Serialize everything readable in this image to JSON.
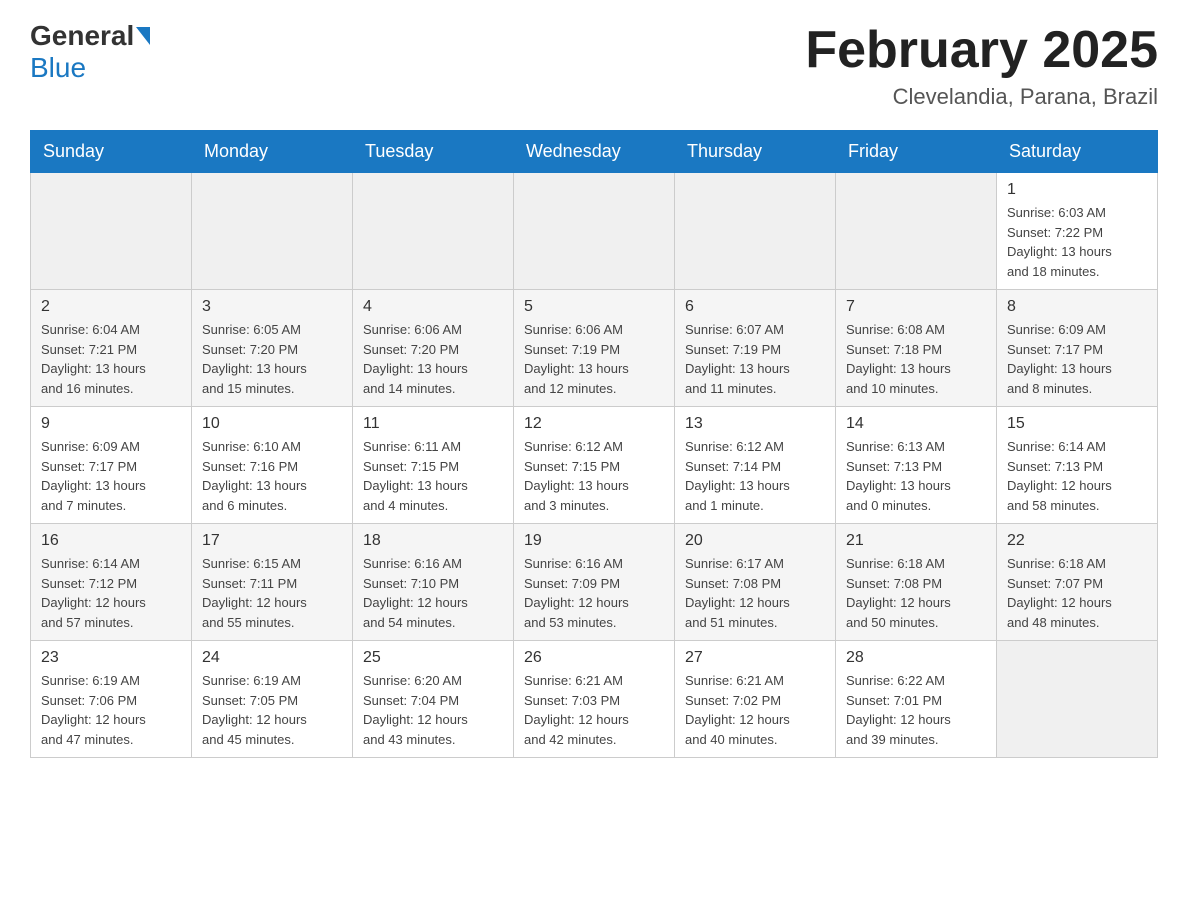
{
  "header": {
    "logo_general": "General",
    "logo_blue": "Blue",
    "title": "February 2025",
    "location": "Clevelandia, Parana, Brazil"
  },
  "weekdays": [
    "Sunday",
    "Monday",
    "Tuesday",
    "Wednesday",
    "Thursday",
    "Friday",
    "Saturday"
  ],
  "weeks": [
    [
      {
        "day": "",
        "info": ""
      },
      {
        "day": "",
        "info": ""
      },
      {
        "day": "",
        "info": ""
      },
      {
        "day": "",
        "info": ""
      },
      {
        "day": "",
        "info": ""
      },
      {
        "day": "",
        "info": ""
      },
      {
        "day": "1",
        "info": "Sunrise: 6:03 AM\nSunset: 7:22 PM\nDaylight: 13 hours\nand 18 minutes."
      }
    ],
    [
      {
        "day": "2",
        "info": "Sunrise: 6:04 AM\nSunset: 7:21 PM\nDaylight: 13 hours\nand 16 minutes."
      },
      {
        "day": "3",
        "info": "Sunrise: 6:05 AM\nSunset: 7:20 PM\nDaylight: 13 hours\nand 15 minutes."
      },
      {
        "day": "4",
        "info": "Sunrise: 6:06 AM\nSunset: 7:20 PM\nDaylight: 13 hours\nand 14 minutes."
      },
      {
        "day": "5",
        "info": "Sunrise: 6:06 AM\nSunset: 7:19 PM\nDaylight: 13 hours\nand 12 minutes."
      },
      {
        "day": "6",
        "info": "Sunrise: 6:07 AM\nSunset: 7:19 PM\nDaylight: 13 hours\nand 11 minutes."
      },
      {
        "day": "7",
        "info": "Sunrise: 6:08 AM\nSunset: 7:18 PM\nDaylight: 13 hours\nand 10 minutes."
      },
      {
        "day": "8",
        "info": "Sunrise: 6:09 AM\nSunset: 7:17 PM\nDaylight: 13 hours\nand 8 minutes."
      }
    ],
    [
      {
        "day": "9",
        "info": "Sunrise: 6:09 AM\nSunset: 7:17 PM\nDaylight: 13 hours\nand 7 minutes."
      },
      {
        "day": "10",
        "info": "Sunrise: 6:10 AM\nSunset: 7:16 PM\nDaylight: 13 hours\nand 6 minutes."
      },
      {
        "day": "11",
        "info": "Sunrise: 6:11 AM\nSunset: 7:15 PM\nDaylight: 13 hours\nand 4 minutes."
      },
      {
        "day": "12",
        "info": "Sunrise: 6:12 AM\nSunset: 7:15 PM\nDaylight: 13 hours\nand 3 minutes."
      },
      {
        "day": "13",
        "info": "Sunrise: 6:12 AM\nSunset: 7:14 PM\nDaylight: 13 hours\nand 1 minute."
      },
      {
        "day": "14",
        "info": "Sunrise: 6:13 AM\nSunset: 7:13 PM\nDaylight: 13 hours\nand 0 minutes."
      },
      {
        "day": "15",
        "info": "Sunrise: 6:14 AM\nSunset: 7:13 PM\nDaylight: 12 hours\nand 58 minutes."
      }
    ],
    [
      {
        "day": "16",
        "info": "Sunrise: 6:14 AM\nSunset: 7:12 PM\nDaylight: 12 hours\nand 57 minutes."
      },
      {
        "day": "17",
        "info": "Sunrise: 6:15 AM\nSunset: 7:11 PM\nDaylight: 12 hours\nand 55 minutes."
      },
      {
        "day": "18",
        "info": "Sunrise: 6:16 AM\nSunset: 7:10 PM\nDaylight: 12 hours\nand 54 minutes."
      },
      {
        "day": "19",
        "info": "Sunrise: 6:16 AM\nSunset: 7:09 PM\nDaylight: 12 hours\nand 53 minutes."
      },
      {
        "day": "20",
        "info": "Sunrise: 6:17 AM\nSunset: 7:08 PM\nDaylight: 12 hours\nand 51 minutes."
      },
      {
        "day": "21",
        "info": "Sunrise: 6:18 AM\nSunset: 7:08 PM\nDaylight: 12 hours\nand 50 minutes."
      },
      {
        "day": "22",
        "info": "Sunrise: 6:18 AM\nSunset: 7:07 PM\nDaylight: 12 hours\nand 48 minutes."
      }
    ],
    [
      {
        "day": "23",
        "info": "Sunrise: 6:19 AM\nSunset: 7:06 PM\nDaylight: 12 hours\nand 47 minutes."
      },
      {
        "day": "24",
        "info": "Sunrise: 6:19 AM\nSunset: 7:05 PM\nDaylight: 12 hours\nand 45 minutes."
      },
      {
        "day": "25",
        "info": "Sunrise: 6:20 AM\nSunset: 7:04 PM\nDaylight: 12 hours\nand 43 minutes."
      },
      {
        "day": "26",
        "info": "Sunrise: 6:21 AM\nSunset: 7:03 PM\nDaylight: 12 hours\nand 42 minutes."
      },
      {
        "day": "27",
        "info": "Sunrise: 6:21 AM\nSunset: 7:02 PM\nDaylight: 12 hours\nand 40 minutes."
      },
      {
        "day": "28",
        "info": "Sunrise: 6:22 AM\nSunset: 7:01 PM\nDaylight: 12 hours\nand 39 minutes."
      },
      {
        "day": "",
        "info": ""
      }
    ]
  ]
}
